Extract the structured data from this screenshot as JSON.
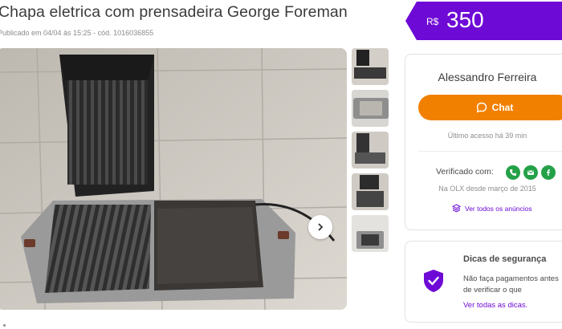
{
  "listing": {
    "title": "Chapa eletrica com prensadeira George Foreman",
    "published": "Publicado em 04/04 às 15:25 - cód. 1016036855"
  },
  "price": {
    "currency": "R$",
    "value": "350",
    "color": "#6e0ad6"
  },
  "gallery": {
    "thumbnail_count": 5
  },
  "seller": {
    "name": "Alessandro Ferreira",
    "chat_label": "Chat",
    "last_access": "Último acesso há 39 min",
    "verified_label": "Verificado com:",
    "verified_icons": [
      "phone-icon",
      "email-icon",
      "facebook-icon"
    ],
    "since": "Na OLX desde março de 2015",
    "see_all": "Ver todos os anúncios",
    "accent": "#f28000"
  },
  "safety": {
    "title": "Dicas de segurança",
    "body": "Não faça pagamentos antes de verificar o que",
    "link": "Ver todas as dicas."
  }
}
